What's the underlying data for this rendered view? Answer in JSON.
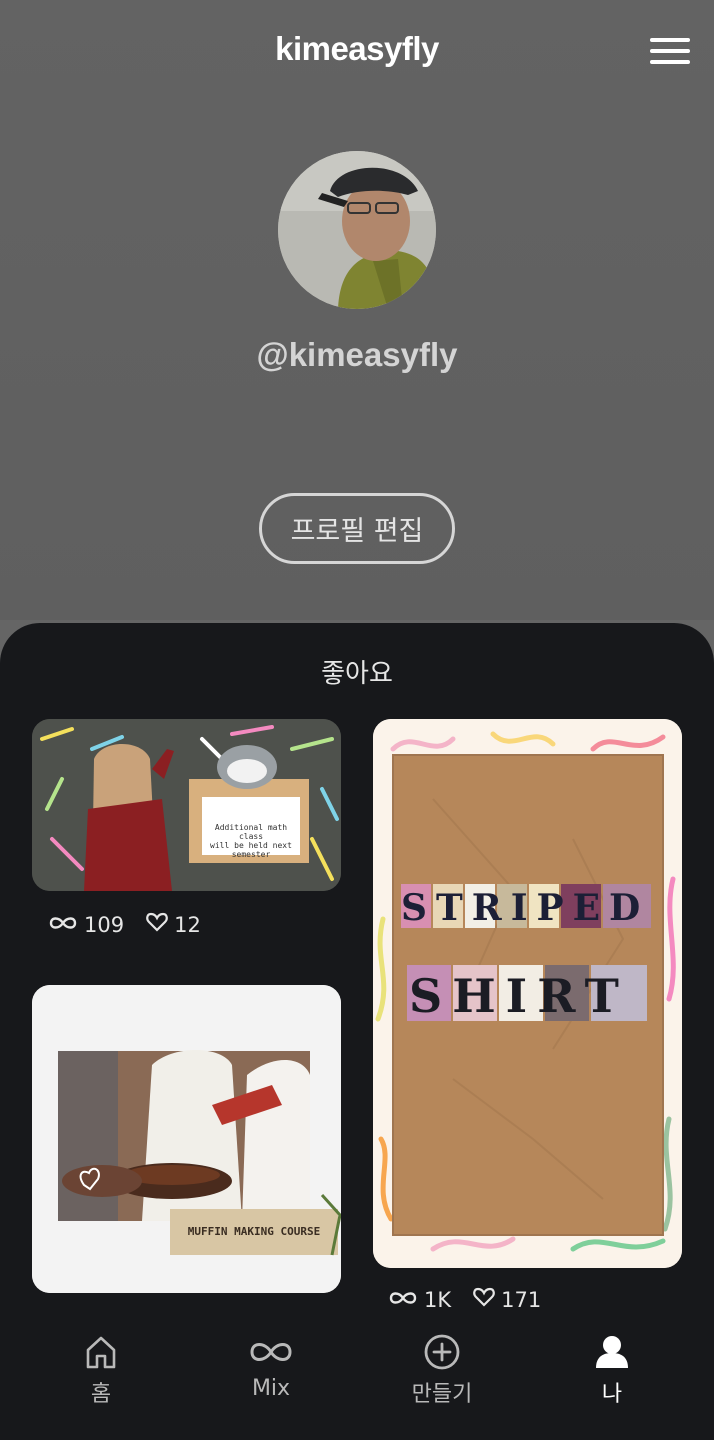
{
  "header": {
    "brand": "kimeasyfly",
    "menu_icon": "hamburger-menu-icon",
    "handle": "@kimeasyfly",
    "edit_profile_label": "프로필 편집"
  },
  "panel": {
    "title": "좋아요"
  },
  "cards": [
    {
      "board_text_line1": "Additional math class",
      "board_text_line2": "will be held next semester",
      "remix_count": "109",
      "like_count": "12"
    },
    {
      "line1": "STRIPED",
      "line2": "SHIRT",
      "remix_count": "1K",
      "like_count": "171"
    },
    {
      "banner": "MUFFIN MAKING COURSE"
    }
  ],
  "tabbar": {
    "items": [
      {
        "label": "홈",
        "icon": "home-icon"
      },
      {
        "label": "Mix",
        "icon": "mix-infinity-icon"
      },
      {
        "label": "만들기",
        "icon": "create-plus-icon"
      },
      {
        "label": "나",
        "icon": "profile-person-icon"
      }
    ],
    "active": "나"
  },
  "colors": {
    "header_bg": "#636363",
    "panel_bg": "#17181b",
    "accent_white": "#ffffff"
  }
}
